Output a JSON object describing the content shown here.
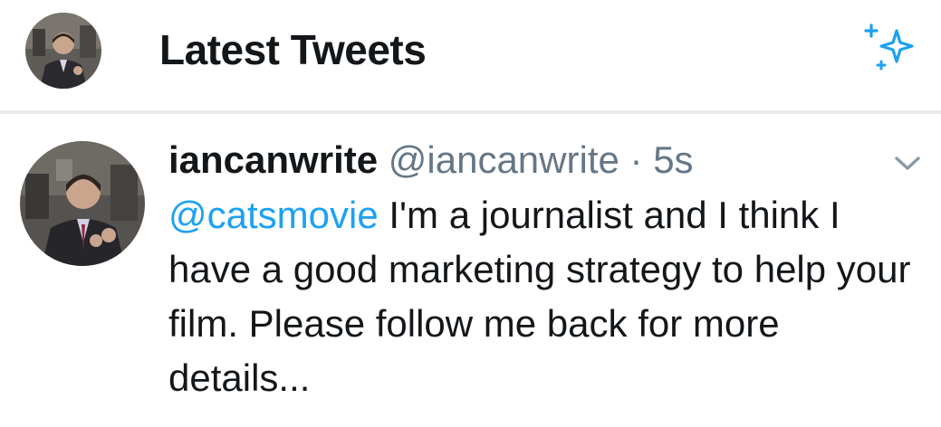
{
  "header": {
    "title": "Latest Tweets",
    "avatar_icon": "profile-photo",
    "sparkle_icon": "sparkle-icon",
    "accent_color": "#1da1f2"
  },
  "tweet": {
    "display_name": "iancanwrite",
    "handle": "@iancanwrite",
    "separator": "·",
    "time": "5s",
    "mention": "@catsmovie",
    "text": " I'm a journalist and I think I have a good marketing strategy to help your film. Please follow me back for more details...",
    "caret_icon": "chevron-down-icon"
  },
  "colors": {
    "text_primary": "#14171a",
    "text_secondary": "#657786",
    "link": "#1da1f2",
    "divider": "#e6ecf0"
  }
}
